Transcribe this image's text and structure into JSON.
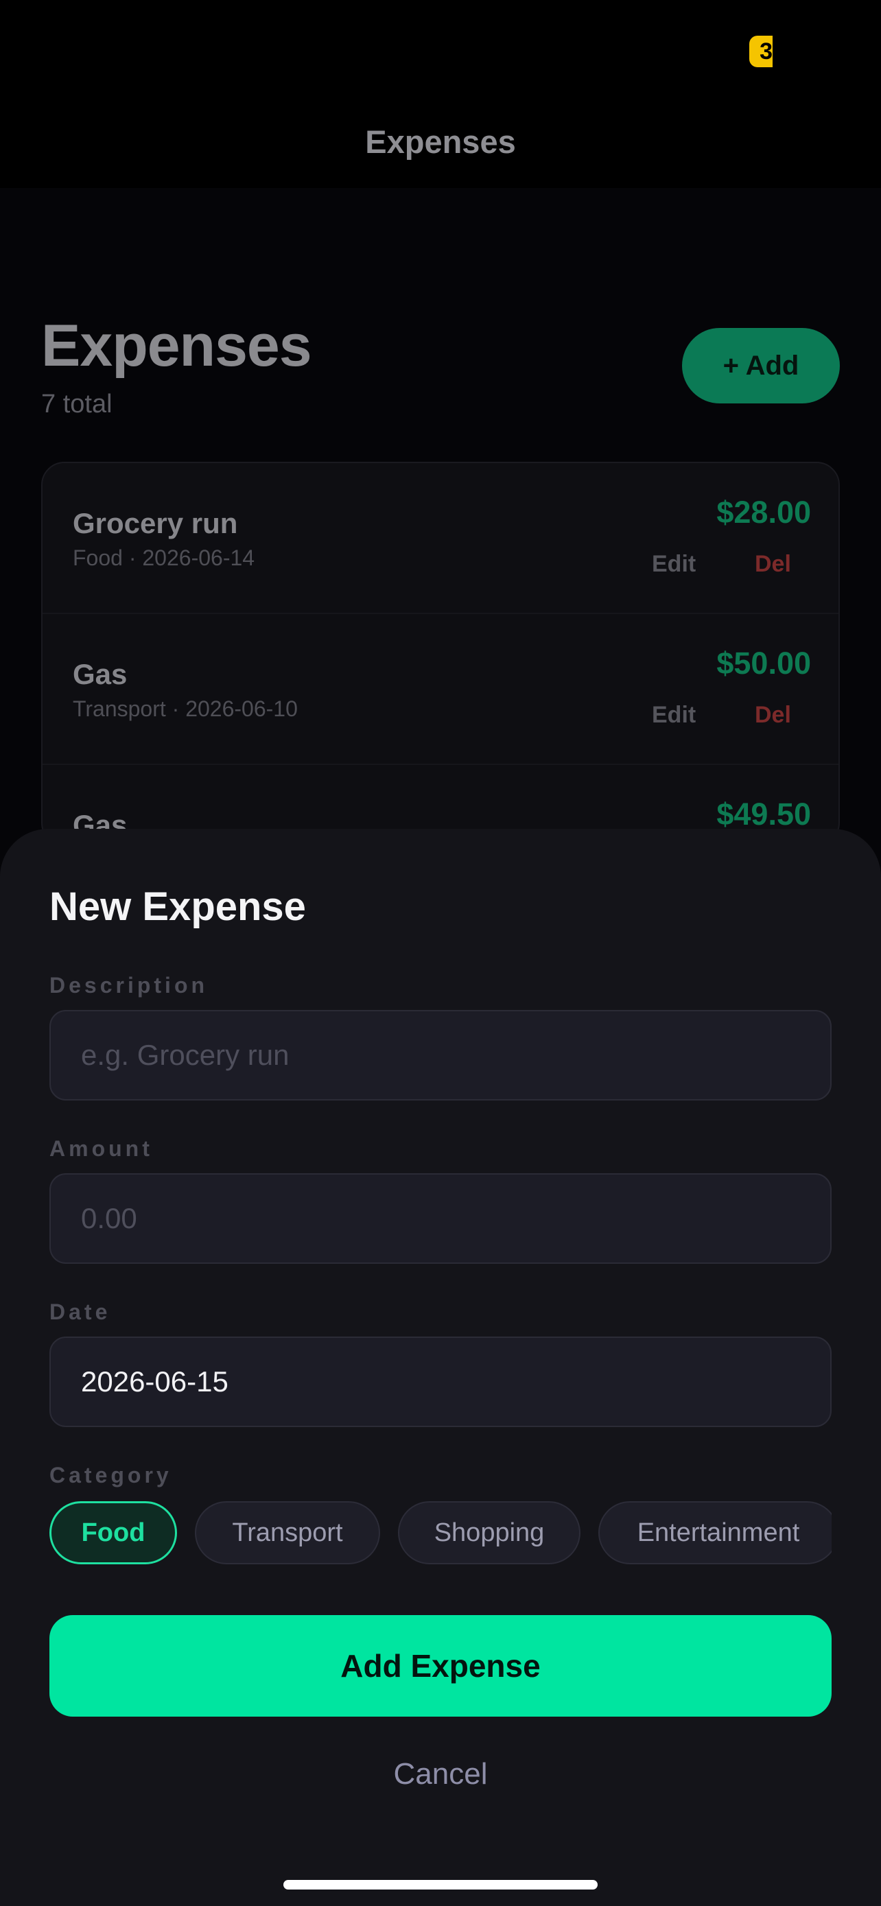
{
  "status_bar": {
    "badge": "3"
  },
  "nav": {
    "title": "Expenses"
  },
  "header": {
    "title": "Expenses",
    "subtitle": "7 total",
    "add_label": "+ Add"
  },
  "expenses": [
    {
      "name": "Grocery run",
      "meta": "Food · 2026-06-14",
      "amount": "$28.00",
      "edit": "Edit",
      "del": "Del"
    },
    {
      "name": "Gas",
      "meta": "Transport · 2026-06-10",
      "amount": "$50.00",
      "edit": "Edit",
      "del": "Del"
    },
    {
      "name": "Gas",
      "amount": "$49.50"
    }
  ],
  "sheet": {
    "title": "New Expense",
    "description": {
      "label": "Description",
      "placeholder": "e.g. Grocery run",
      "value": ""
    },
    "amount": {
      "label": "Amount",
      "placeholder": "0.00",
      "value": ""
    },
    "date": {
      "label": "Date",
      "value": "2026-06-15"
    },
    "category": {
      "label": "Category",
      "selected": "Food",
      "options": [
        "Food",
        "Transport",
        "Shopping",
        "Entertainment"
      ]
    },
    "submit_label": "Add Expense",
    "cancel_label": "Cancel"
  },
  "colors": {
    "accent": "#00e5a0",
    "amount_green": "#0d7a52",
    "delete_red": "#7c2a2a",
    "status_yellow": "#f5c400"
  }
}
